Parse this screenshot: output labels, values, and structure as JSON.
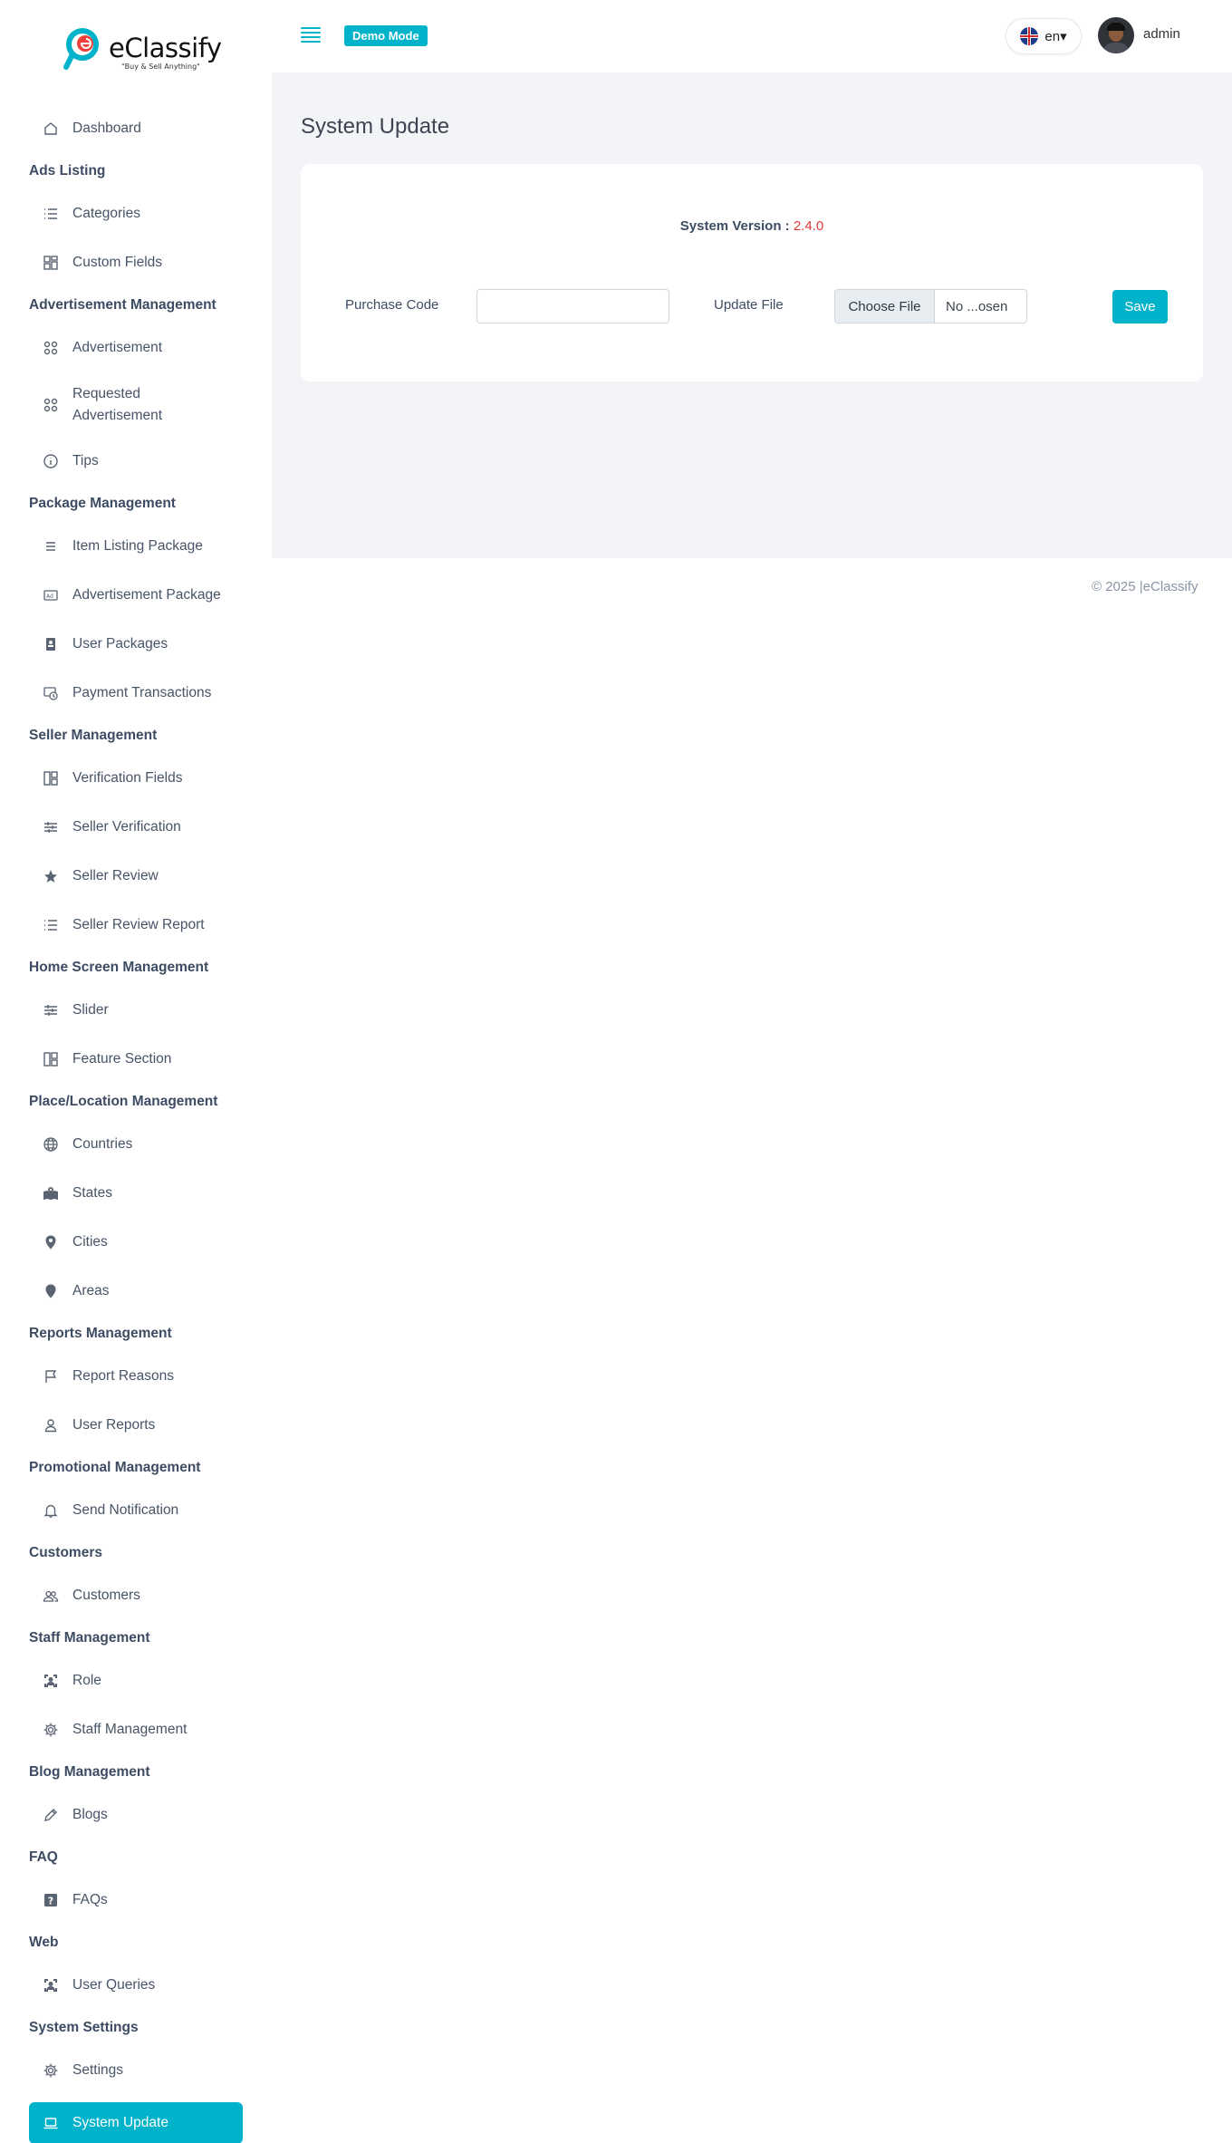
{
  "brand": {
    "name": "eClassify",
    "tagline": "\"Buy & Sell Anything\""
  },
  "header": {
    "demo_badge": "Demo Mode",
    "language": "en▾",
    "user_name": "admin"
  },
  "sidebar": {
    "dashboard": "Dashboard",
    "groups": {
      "ads_listing": "Ads Listing",
      "advertisement_management": "Advertisement Management",
      "package_management": "Package Management",
      "seller_management": "Seller Management",
      "home_screen_management": "Home Screen Management",
      "place_location_management": "Place/Location Management",
      "reports_management": "Reports Management",
      "promotional_management": "Promotional Management",
      "customers": "Customers",
      "staff_management": "Staff Management",
      "blog_management": "Blog Management",
      "faq": "FAQ",
      "web": "Web",
      "system_settings": "System Settings"
    },
    "items": {
      "categories": "Categories",
      "custom_fields": "Custom Fields",
      "advertisement": "Advertisement",
      "requested_advertisement_1": "Requested",
      "requested_advertisement_2": "Advertisement",
      "tips": "Tips",
      "item_listing_package": "Item Listing Package",
      "advertisement_package": "Advertisement Package",
      "user_packages": "User Packages",
      "payment_transactions": "Payment Transactions",
      "verification_fields": "Verification Fields",
      "seller_verification": "Seller Verification",
      "seller_review": "Seller Review",
      "seller_review_report": "Seller Review Report",
      "slider": "Slider",
      "feature_section": "Feature Section",
      "countries": "Countries",
      "states": "States",
      "cities": "Cities",
      "areas": "Areas",
      "report_reasons": "Report Reasons",
      "user_reports": "User Reports",
      "send_notification": "Send Notification",
      "customers": "Customers",
      "role": "Role",
      "staff_management": "Staff Management",
      "blogs": "Blogs",
      "faqs": "FAQs",
      "user_queries": "User Queries",
      "settings": "Settings",
      "system_update": "System Update"
    }
  },
  "main": {
    "title": "System Update",
    "version_label": "System Version :",
    "version_value": "2.4.0",
    "purchase_code_label": "Purchase Code",
    "purchase_code_value": "",
    "update_file_label": "Update File",
    "choose_file_label": "Choose File",
    "file_status": "No ...osen",
    "save_label": "Save"
  },
  "footer": {
    "copyright": "© 2025 |eClassify"
  },
  "colors": {
    "accent": "#00b2ca",
    "version": "#e23b3b",
    "content_bg": "#f3f4f7"
  }
}
